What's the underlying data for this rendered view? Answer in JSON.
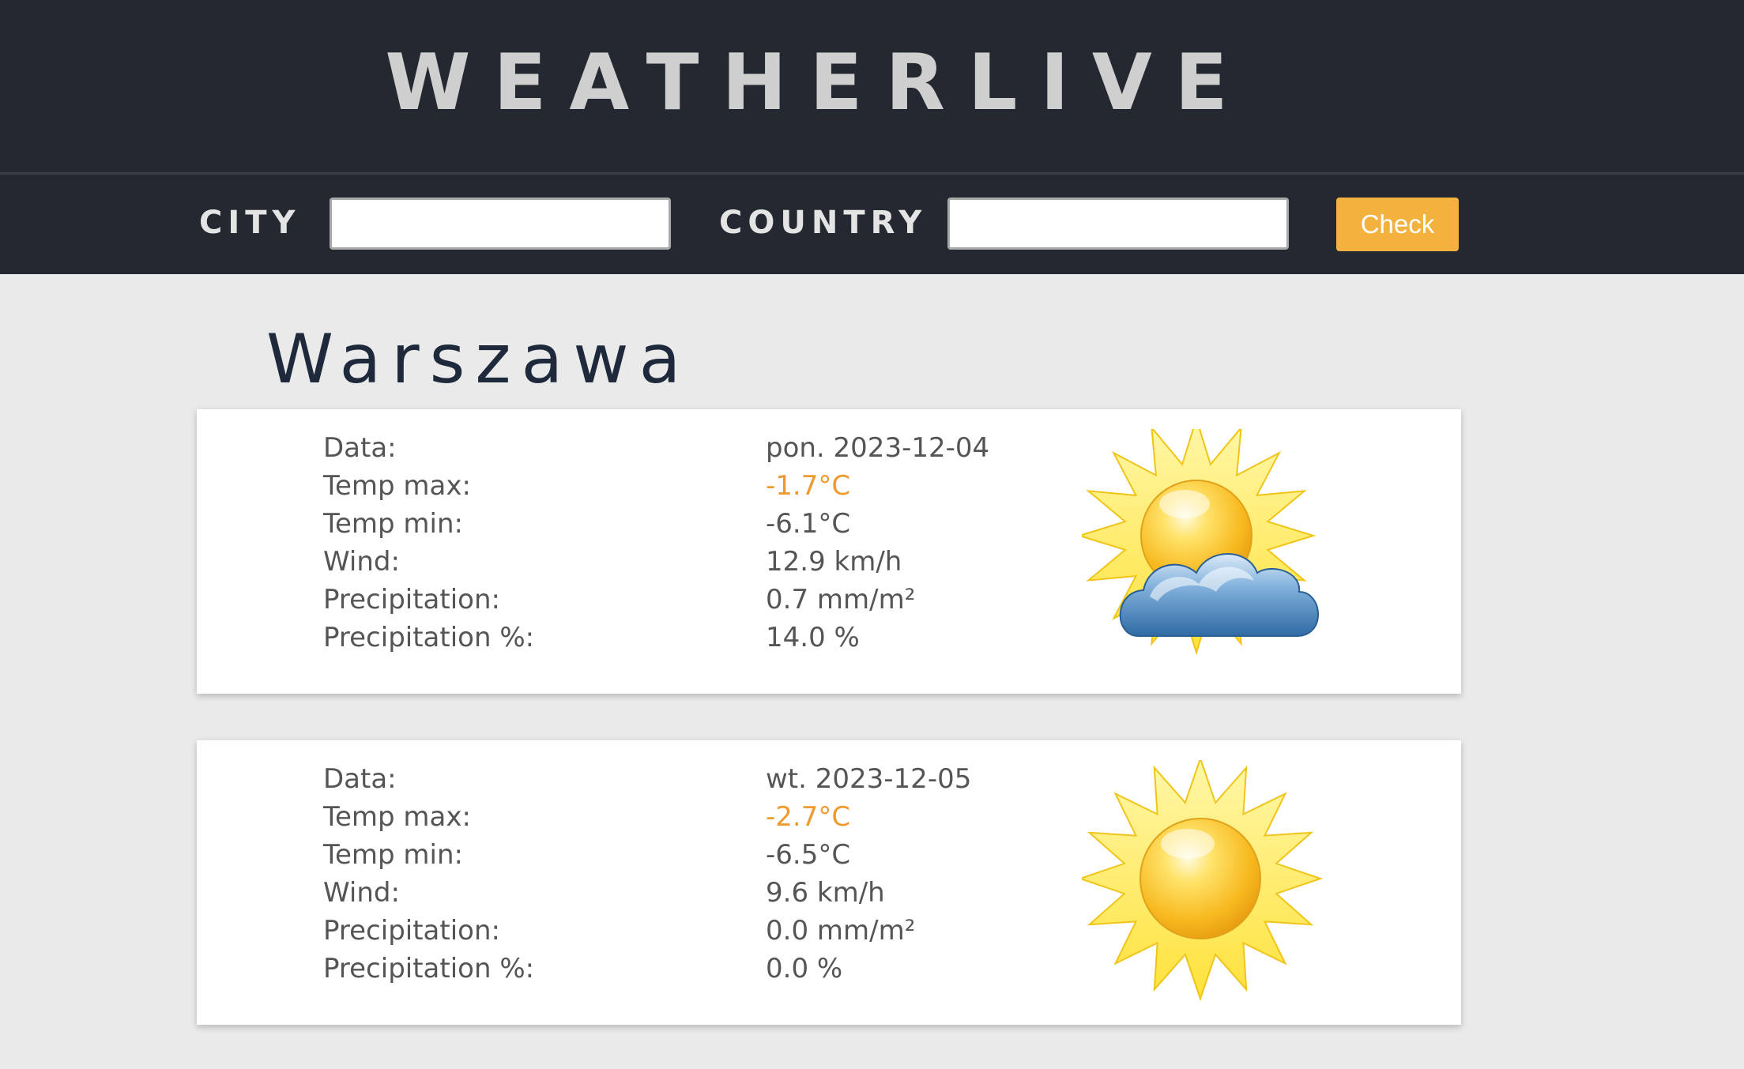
{
  "header": {
    "title": "WEATHERLIVE"
  },
  "search": {
    "city_label": "CITY",
    "city_value": "",
    "country_label": "COUNTRY",
    "country_value": "",
    "button_label": "Check"
  },
  "location": {
    "name": "Warszawa"
  },
  "colors": {
    "header_bg": "#242830",
    "accent_button": "#f2b23d",
    "temp_max": "#ef9a2c",
    "page_bg": "#eaeaea"
  },
  "forecast": [
    {
      "icon": "sun-cloud-icon",
      "rows": [
        {
          "label": "Data:",
          "value": "pon. 2023-12-04"
        },
        {
          "label": "Temp max:",
          "value": "-1.7°C"
        },
        {
          "label": "Temp min:",
          "value": "-6.1°C"
        },
        {
          "label": "Wind:",
          "value": "12.9 km/h"
        },
        {
          "label": "Precipitation:",
          "value": "0.7 mm/m²"
        },
        {
          "label": "Precipitation %:",
          "value": "14.0 %"
        }
      ]
    },
    {
      "icon": "sun-icon",
      "rows": [
        {
          "label": "Data:",
          "value": "wt. 2023-12-05"
        },
        {
          "label": "Temp max:",
          "value": "-2.7°C"
        },
        {
          "label": "Temp min:",
          "value": "-6.5°C"
        },
        {
          "label": "Wind:",
          "value": "9.6 km/h"
        },
        {
          "label": "Precipitation:",
          "value": "0.0 mm/m²"
        },
        {
          "label": "Precipitation %:",
          "value": "0.0 %"
        }
      ]
    }
  ]
}
